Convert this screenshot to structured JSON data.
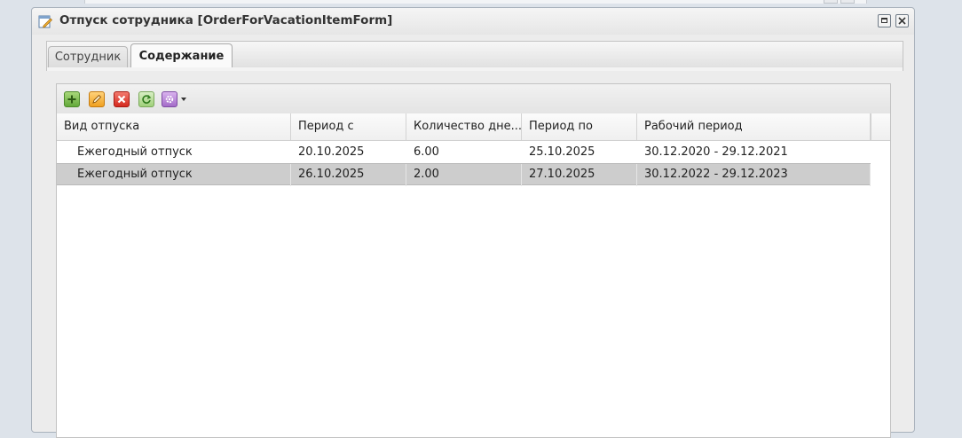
{
  "window": {
    "title": "Отпуск сотрудника [OrderForVacationItemForm]",
    "icon": "edit-document-icon"
  },
  "tabs": [
    {
      "label": "Сотрудник",
      "active": false
    },
    {
      "label": "Содержание",
      "active": true
    }
  ],
  "toolbar": {
    "buttons": [
      {
        "name": "add-button",
        "icon": "plus-icon",
        "color": "#63a93a"
      },
      {
        "name": "edit-button",
        "icon": "pencil-icon",
        "color": "#f0a020"
      },
      {
        "name": "delete-button",
        "icon": "close-icon",
        "color": "#d42a1f"
      },
      {
        "name": "refresh-button",
        "icon": "refresh-icon",
        "color": "#9fd07a"
      },
      {
        "name": "settings-button",
        "icon": "gear-icon",
        "color": "#a36cc8"
      }
    ]
  },
  "grid": {
    "columns": [
      "Вид отпуска",
      "Период с",
      "Количество дне...",
      "Период по",
      "Рабочий период"
    ],
    "rows": [
      [
        "Ежегодный отпуск",
        "20.10.2025",
        "6.00",
        "25.10.2025",
        "30.12.2020 - 29.12.2021"
      ],
      [
        "Ежегодный отпуск",
        "26.10.2025",
        "2.00",
        "27.10.2025",
        "30.12.2022 - 29.12.2023"
      ]
    ],
    "selected_row": 1
  }
}
